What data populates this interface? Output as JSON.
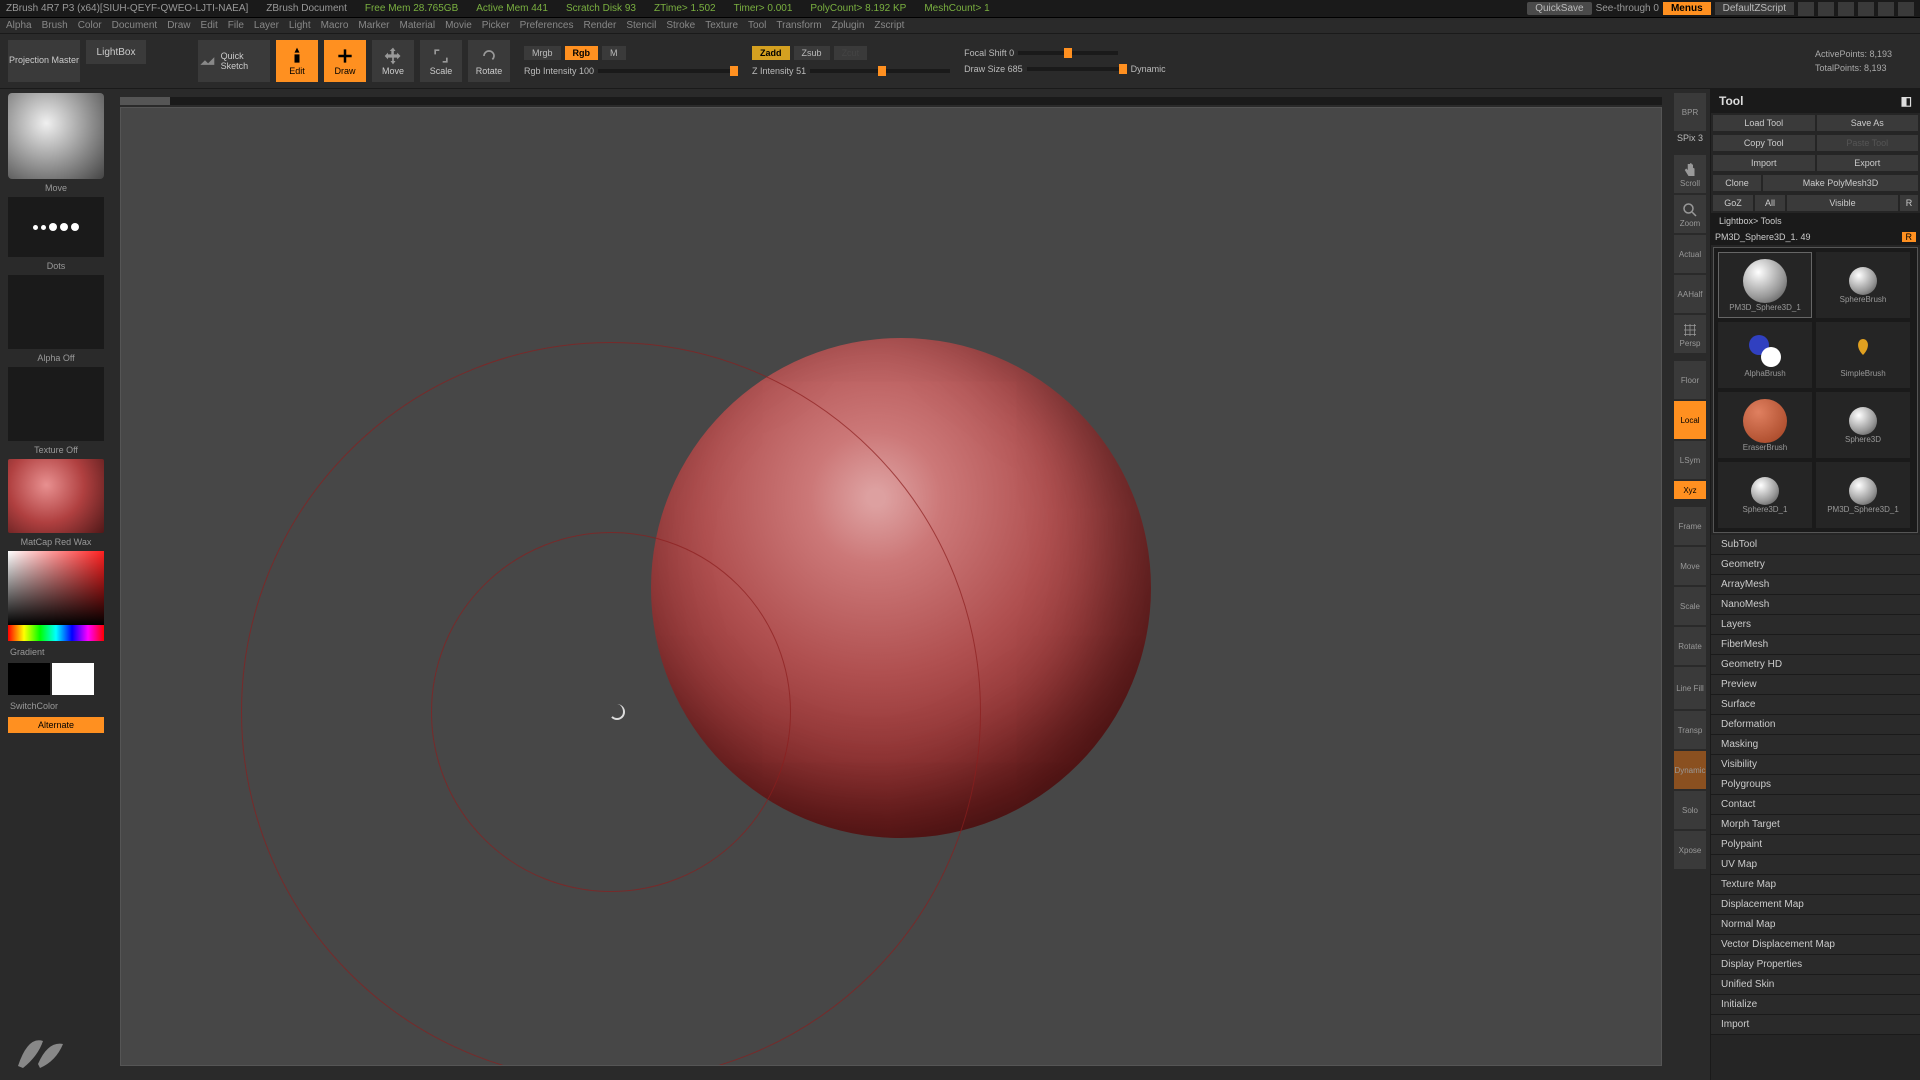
{
  "titlebar": {
    "app": "ZBrush 4R7 P3 (x64)[SIUH-QEYF-QWEO-LJTI-NAEA]",
    "doc": "ZBrush Document",
    "mem": "Free Mem 28.765GB",
    "amem": "Active Mem 441",
    "scratch": "Scratch Disk 93",
    "ztime": "ZTime> 1.502",
    "timer": "Timer> 0.001",
    "poly": "PolyCount> 8.192 KP",
    "mesh": "MeshCount> 1",
    "quicksave": "QuickSave",
    "seethrough": "See-through   0",
    "menus": "Menus",
    "defaultzs": "DefaultZScript"
  },
  "menubar": [
    "Alpha",
    "Brush",
    "Color",
    "Document",
    "Draw",
    "Edit",
    "File",
    "Layer",
    "Light",
    "Macro",
    "Marker",
    "Material",
    "Movie",
    "Picker",
    "Preferences",
    "Render",
    "Stencil",
    "Stroke",
    "Texture",
    "Tool",
    "Transform",
    "Zplugin",
    "Zscript"
  ],
  "toolbar": {
    "projection": "Projection\nMaster",
    "lightbox": "LightBox",
    "quicksketch": "Quick\nSketch",
    "edit": "Edit",
    "draw": "Draw",
    "move": "Move",
    "scale": "Scale",
    "rotate": "Rotate",
    "mrgb": "Mrgb",
    "rgb": "Rgb",
    "m": "M",
    "rgb_int": "Rgb Intensity 100",
    "zadd": "Zadd",
    "zsub": "Zsub",
    "zcut": "Zcut",
    "zint": "Z Intensity 51",
    "focal": "Focal Shift 0",
    "drawsize": "Draw Size 685",
    "dynamic": "Dynamic",
    "active_pts": "ActivePoints: 8,193",
    "total_pts": "TotalPoints: 8,193"
  },
  "left": {
    "move": "Move",
    "dots": "Dots",
    "alpha_off": "Alpha Off",
    "texture_off": "Texture Off",
    "matcap": "MatCap Red Wax",
    "gradient": "Gradient",
    "switchcolor": "SwitchColor",
    "alternate": "Alternate"
  },
  "righticons": {
    "bpr": "BPR",
    "spix": "SPix 3",
    "scroll": "Scroll",
    "zoom": "Zoom",
    "actual": "Actual",
    "aahalf": "AAHalf",
    "persp": "Persp",
    "floor": "Floor",
    "local": "Local",
    "lsym": "LSym",
    "xyz": "Xyz",
    "frame": "Frame",
    "move": "Move",
    "scale": "Scale",
    "rotate": "Rotate",
    "linefill": "Line Fill",
    "transp": "Transp",
    "dynamic": "Dynamic",
    "solo": "Solo",
    "xpose": "Xpose"
  },
  "panel": {
    "title": "Tool",
    "load": "Load Tool",
    "saveas": "Save As",
    "copy": "Copy Tool",
    "paste": "Paste Tool",
    "import": "Import",
    "export": "Export",
    "clone": "Clone",
    "makepoly": "Make PolyMesh3D",
    "goz": "GoZ",
    "all": "All",
    "visible": "Visible",
    "r": "R",
    "lightbox_tools": "Lightbox> Tools",
    "toolname": "PM3D_Sphere3D_1. 49",
    "thumbs": [
      {
        "label": "PM3D_Sphere3D_1"
      },
      {
        "label": "SphereBrush"
      },
      {
        "label": "AlphaBrush"
      },
      {
        "label": "SimpleBrush"
      },
      {
        "label": "EraserBrush"
      },
      {
        "label": "Sphere3D"
      },
      {
        "label": "Sphere3D_1"
      },
      {
        "label": "PM3D_Sphere3D_1"
      }
    ],
    "accordion": [
      "SubTool",
      "Geometry",
      "ArrayMesh",
      "NanoMesh",
      "Layers",
      "FiberMesh",
      "Geometry HD",
      "Preview",
      "Surface",
      "Deformation",
      "Masking",
      "Visibility",
      "Polygroups",
      "Contact",
      "Morph Target",
      "Polypaint",
      "UV Map",
      "Texture Map",
      "Displacement Map",
      "Normal Map",
      "Vector Displacement Map",
      "Display Properties",
      "Unified Skin",
      "Initialize",
      "Import"
    ]
  }
}
